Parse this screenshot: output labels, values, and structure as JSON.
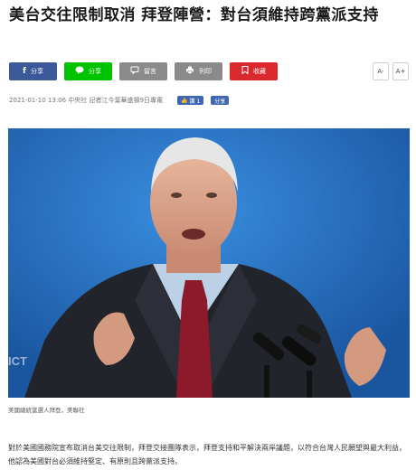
{
  "article": {
    "headline": "美台交往限制取消 拜登陣營：對台須維持跨黨派支持",
    "meta_text": "2021-01-10 13:06 中央社 記者江今葉華盛頓9日專電",
    "caption": "美國總統當選人拜登，美聯社",
    "body": "對於美國國務院宣布取消台美交往限制，拜登交接團隊表示，拜登支持和平解決兩岸議題，以符合台灣人民願望與最大利益，他認為美國對台必須維持堅定、有原則且跨黨派支持。"
  },
  "share_bar": {
    "facebook_label": "分享",
    "line_label": "分享",
    "comment_label": "留言",
    "print_label": "列印",
    "bookmark_label": "收藏",
    "font_smaller": "A-",
    "font_larger": "A+"
  },
  "social": {
    "like_label": "讚 1",
    "share_label": "分享"
  },
  "icons": {
    "facebook": "f",
    "line": "line-bubble",
    "comment": "comment",
    "print": "printer",
    "bookmark": "bookmark"
  },
  "colors": {
    "facebook": "#3b5998",
    "line": "#00c300",
    "comment": "#8a8a8a",
    "print": "#8a8a8a",
    "bookmark": "#d9292c",
    "photo_background": "#1e5fae"
  }
}
